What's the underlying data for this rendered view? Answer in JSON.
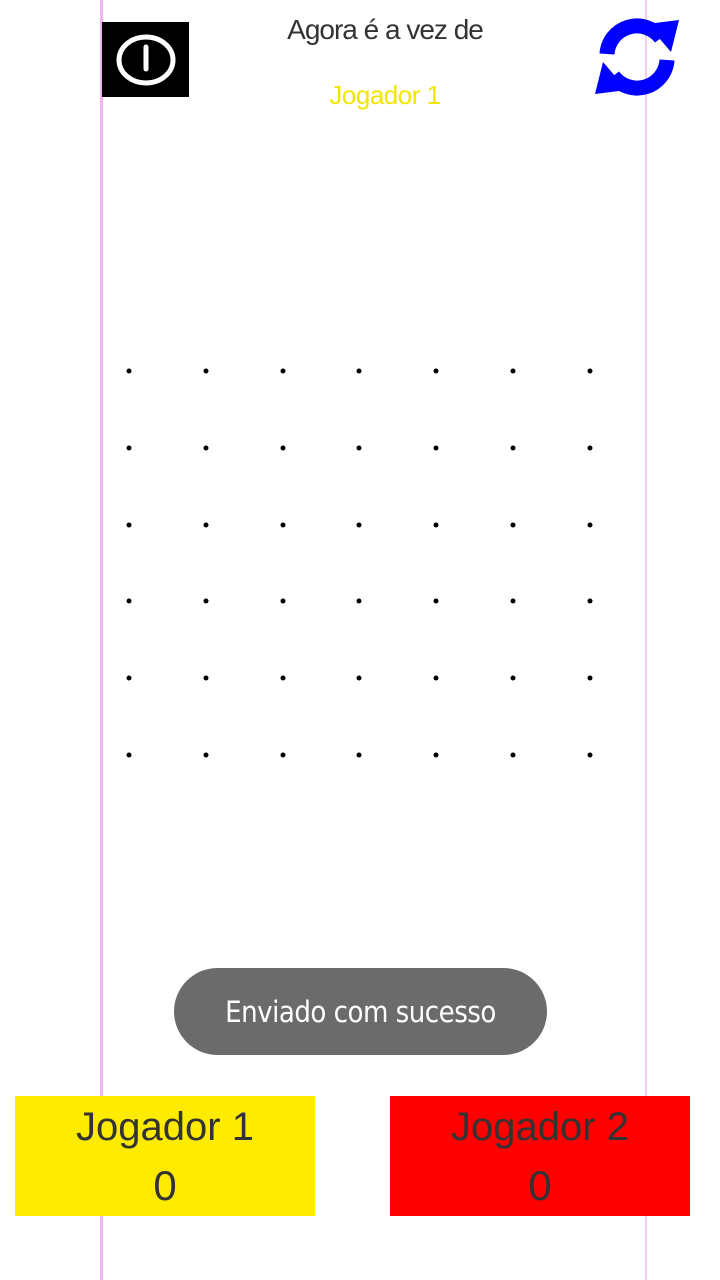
{
  "header": {
    "turn_caption": "Agora é a vez de",
    "current_player": "Jogador 1",
    "power_icon": "power-icon",
    "refresh_icon": "refresh-icon"
  },
  "board": {
    "columns": 7,
    "rows": 6
  },
  "toast": {
    "message": "Enviado com sucesso"
  },
  "scores": [
    {
      "name": "Jogador 1",
      "score": "0",
      "color": "#ffeb00"
    },
    {
      "name": "Jogador 2",
      "score": "0",
      "color": "#ff0000"
    }
  ],
  "colors": {
    "current_player_text": "#f2e600",
    "refresh_icon": "#0000ff",
    "toast_background": "#6b6b6b"
  }
}
